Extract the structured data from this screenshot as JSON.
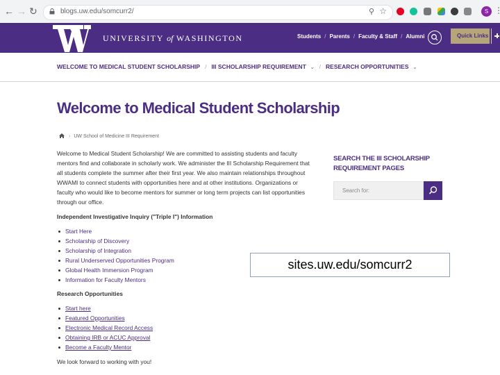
{
  "browser": {
    "url": "blogs.uw.edu/somcurr2/",
    "avatar_initial": "S"
  },
  "header": {
    "university_prefix": "UNIVERSITY",
    "university_of": "of",
    "university_suffix": "WASHINGTON",
    "links": [
      "Students",
      "Parents",
      "Faculty & Staff",
      "Alumni"
    ],
    "quick_links": "Quick Links",
    "brand_color": "#4b2e83",
    "gold_color": "#b7a57a"
  },
  "subnav": {
    "items": [
      "WELCOME TO MEDICAL STUDENT SCHOLARSHIP",
      "III SCHOLARSHIP REQUIREMENT",
      "RESEARCH OPPORTUNITIES"
    ]
  },
  "page": {
    "title": "Welcome to Medical Student Scholarship",
    "breadcrumb": "UW School of Medicine III Requirement",
    "intro": "Welcome to Medical Student Scholarship! We are committed to assisting students and faculty mentors find and collaborate in scholarly work. We administer the III Scholarship Requirement that all students complete the summer after their first year. We also maintain relationships throughout WWAMI to connect students with opportunities here and at other institutions. Organizations or faculty who would like to become mentors for summer or long term projects can list opportunities through our office.",
    "section1_heading": "Independent Investigative Inquiry (\"Triple I\") Information",
    "section1_links": [
      "Start Here",
      "Scholarship of Discovery",
      "Scholarship of Integration",
      "Rural Underserved Opportunities Program",
      "Global Health Immersion Program",
      "Information for Faculty Mentors"
    ],
    "section2_heading": "Research Opportunities",
    "section2_links": [
      "Start here",
      "Featured Opportunities",
      "Electronic Medical Record Access",
      "Obtaining IRB or ACUC Approval",
      "Become a Faculty Mentor"
    ],
    "closing": "We look forward to working with you!"
  },
  "sidebar": {
    "heading": "SEARCH THE III SCHOLARSHIP REQUIREMENT PAGES",
    "search_placeholder": "Search for:"
  },
  "overlay": {
    "caption": "sites.uw.edu/somcurr2"
  }
}
